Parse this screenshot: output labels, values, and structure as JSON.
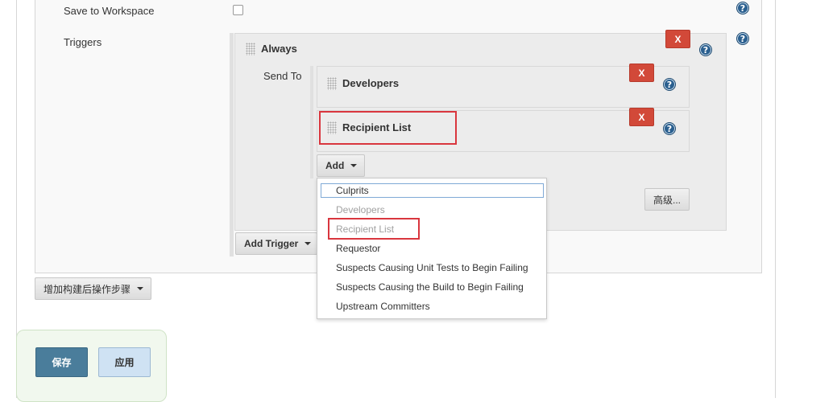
{
  "form": {
    "save_to_workspace_label": "Save to Workspace",
    "triggers_label": "Triggers",
    "send_to_label": "Send To"
  },
  "trigger": {
    "title": "Always",
    "delete_label": "X"
  },
  "recipients": [
    {
      "title": "Developers",
      "delete_label": "X"
    },
    {
      "title": "Recipient List",
      "delete_label": "X"
    }
  ],
  "buttons": {
    "add_label": "Add",
    "add_trigger_label": "Add Trigger",
    "advanced_label": "高级...",
    "add_post_build_label": "增加构建后操作步骤",
    "save_label": "保存",
    "apply_label": "应用"
  },
  "dropdown": {
    "items": [
      {
        "label": "Culprits",
        "enabled": true
      },
      {
        "label": "Developers",
        "enabled": false
      },
      {
        "label": "Recipient List",
        "enabled": false
      },
      {
        "label": "Requestor",
        "enabled": true
      },
      {
        "label": "Suspects Causing Unit Tests to Begin Failing",
        "enabled": true
      },
      {
        "label": "Suspects Causing the Build to Begin Failing",
        "enabled": true
      },
      {
        "label": "Upstream Committers",
        "enabled": true
      }
    ]
  },
  "icons": {
    "help": "help-icon",
    "grip": "drag-handle-icon",
    "caret": "caret-down-icon"
  },
  "colors": {
    "delete_button": "#d24939",
    "highlight_outline": "#d9363e",
    "save_button": "#4a7d9b",
    "apply_button": "#cfe2f3",
    "help_icon": "#2a5f8f"
  }
}
